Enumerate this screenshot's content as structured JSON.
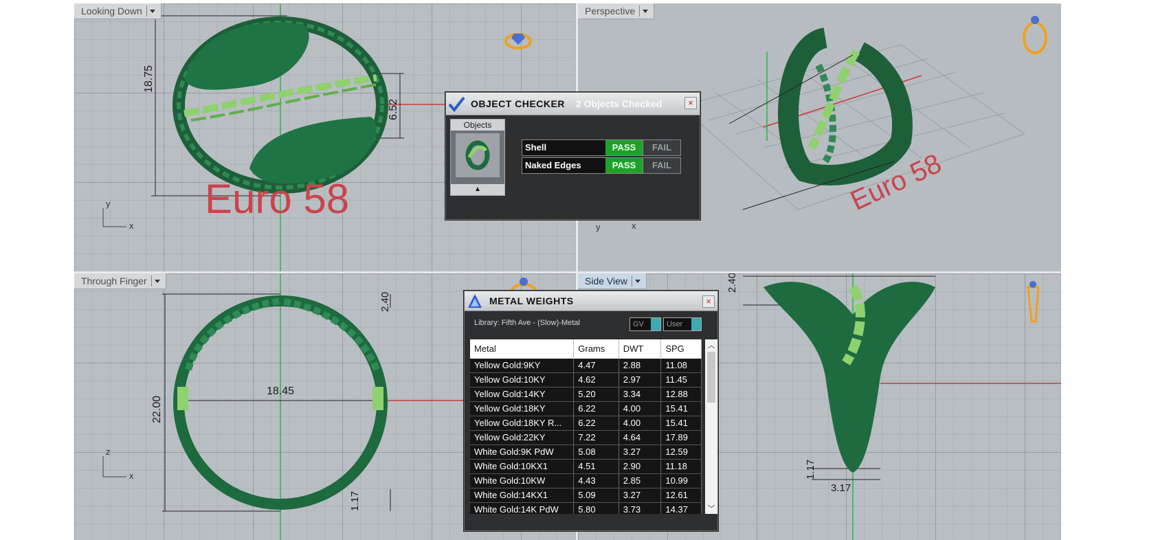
{
  "viewports": {
    "top_left": {
      "label": "Looking Down",
      "size_label": "Euro 58",
      "dims": {
        "height": "18.75",
        "width": "6.52"
      },
      "axes": {
        "v": "y",
        "h": "x"
      }
    },
    "top_right": {
      "label": "Perspective",
      "size_label": "Euro 58",
      "axes": {
        "v": "y",
        "h": "x"
      }
    },
    "bottom_left": {
      "label": "Through Finger",
      "dims": {
        "top": "2.40",
        "height": "22.00",
        "inner": "18.45",
        "bottom": "1.17"
      },
      "axes": {
        "v": "z",
        "h": "x"
      }
    },
    "bottom_right": {
      "label": "Side View",
      "dims": {
        "top": "2.40",
        "bottom_h": "1.17",
        "bottom_w": "3.17"
      }
    }
  },
  "object_checker": {
    "title": "OBJECT CHECKER",
    "count_text": "2  Objects Checked",
    "close": "×",
    "objects_label": "Objects",
    "checks": [
      {
        "name": "Shell",
        "pass": "PASS",
        "fail": "FAIL"
      },
      {
        "name": "Naked Edges",
        "pass": "PASS",
        "fail": "FAIL"
      }
    ]
  },
  "metal_weights": {
    "title": "METAL WEIGHTS",
    "close": "×",
    "library": "Library: Fifth Ave - (Slow)-Metal",
    "toggle1": "GV",
    "toggle2": "User",
    "columns": [
      "Metal",
      "Grams",
      "DWT",
      "SPG"
    ],
    "rows": [
      [
        "Yellow Gold:9KY",
        "4.47",
        "2.88",
        "11.08"
      ],
      [
        "Yellow Gold:10KY",
        "4.62",
        "2.97",
        "11.45"
      ],
      [
        "Yellow Gold:14KY",
        "5.20",
        "3.34",
        "12.88"
      ],
      [
        "Yellow Gold:18KY",
        "6.22",
        "4.00",
        "15.41"
      ],
      [
        "Yellow Gold:18KY R...",
        "6.22",
        "4.00",
        "15.41"
      ],
      [
        "Yellow Gold:22KY",
        "7.22",
        "4.64",
        "17.89"
      ],
      [
        "White Gold:9K PdW",
        "5.08",
        "3.27",
        "12.59"
      ],
      [
        "White Gold:10KX1",
        "4.51",
        "2.90",
        "11.18"
      ],
      [
        "White Gold:10KW",
        "4.43",
        "2.85",
        "10.99"
      ],
      [
        "White Gold:14KX1",
        "5.09",
        "3.27",
        "12.61"
      ],
      [
        "White Gold:14K PdW",
        "5.80",
        "3.73",
        "14.37"
      ]
    ]
  },
  "colors": {
    "ring": "#1e6b3f",
    "chain": "#8fd16e",
    "pass": "#1fa12a",
    "dim_red": "#c9454b"
  }
}
